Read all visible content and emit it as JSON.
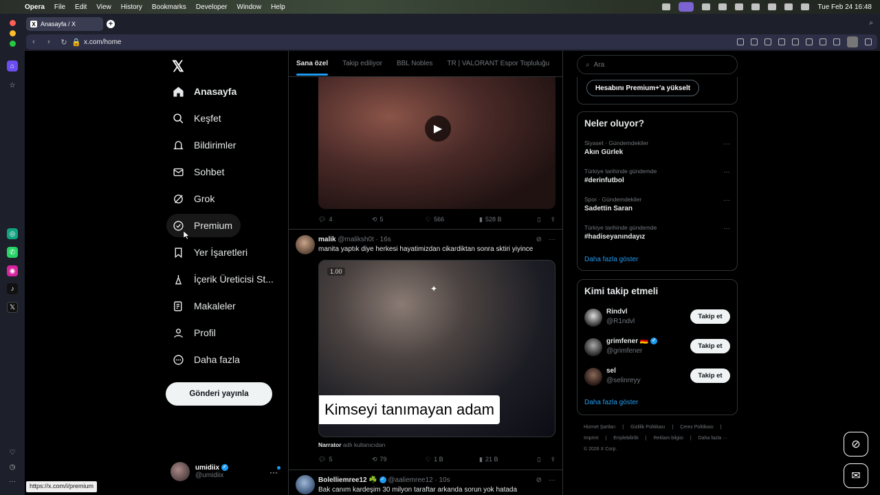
{
  "menubar": {
    "app": "Opera",
    "items": [
      "File",
      "Edit",
      "View",
      "History",
      "Bookmarks",
      "Developer",
      "Window",
      "Help"
    ],
    "datetime": "Tue Feb 24  16:48"
  },
  "tab": {
    "title": "Anasayfa / X"
  },
  "address": {
    "url": "x.com/home"
  },
  "leftnav": {
    "items": [
      {
        "label": "Anasayfa",
        "icon": "home-icon"
      },
      {
        "label": "Keşfet",
        "icon": "search-icon"
      },
      {
        "label": "Bildirimler",
        "icon": "bell-icon"
      },
      {
        "label": "Sohbet",
        "icon": "mail-icon"
      },
      {
        "label": "Grok",
        "icon": "grok-icon"
      },
      {
        "label": "Premium",
        "icon": "verified-icon"
      },
      {
        "label": "Yer İşaretleri",
        "icon": "bookmark-icon"
      },
      {
        "label": "İçerik Üreticisi St...",
        "icon": "creator-icon"
      },
      {
        "label": "Makaleler",
        "icon": "articles-icon"
      },
      {
        "label": "Profil",
        "icon": "profile-icon"
      },
      {
        "label": "Daha fazla",
        "icon": "more-circle-icon"
      }
    ],
    "post_button": "Gönderi yayınla",
    "me": {
      "name": "umidiix",
      "handle": "@umidiix"
    }
  },
  "timeline": {
    "tabs": [
      "Sana özel",
      "Takip ediliyor",
      "BBL Nobles",
      "TR | VALORANT Espor Topluluğu"
    ],
    "tweet1_actions": {
      "replies": "4",
      "reposts": "5",
      "likes": "566",
      "views": "528 B"
    },
    "tweet2": {
      "name": "malik",
      "handle": "@maliksh0t",
      "time": "16s",
      "text": "manita yaptık diye herkesi hayatimizdan cikardiktan sonra sktiri yiyince",
      "timestamp": "1.00",
      "caption": "Kimseyi tanımayan adam",
      "narrator_name": "Narrator",
      "narrator_suffix": "adlı kullanıcıdan",
      "replies": "5",
      "reposts": "79",
      "likes": "1 B",
      "views": "21 B"
    },
    "tweet3": {
      "name": "Bolelliemree12 ☘️",
      "handle": "@aaliemree12",
      "time": "10s",
      "text": "Bak canım kardeşim 30 milyon taraftar arkanda sorun yok hatada"
    }
  },
  "right": {
    "search_placeholder": "Ara",
    "premium_btn": "Hesabını Premium+'a yükselt",
    "trends_title": "Neler oluyor?",
    "trends": [
      {
        "meta": "Siyaset · Gündemdekiler",
        "name": "Akın Gürlek"
      },
      {
        "meta": "Türkiye tarihinde gündemde",
        "name": "#derinfutbol"
      },
      {
        "meta": "Spor · Gündemdekiler",
        "name": "Sadettin Saran"
      },
      {
        "meta": "Türkiye tarihinde gündemde",
        "name": "#hadiseyanındayız"
      }
    ],
    "show_more": "Daha fazla göster",
    "who_title": "Kimi takip etmeli",
    "who": [
      {
        "name": "Rindvl",
        "handle": "@R1ndvl",
        "button": "Takip et"
      },
      {
        "name": "grimfener 🇩🇪",
        "handle": "@grimfener",
        "button": "Takip et"
      },
      {
        "name": "sel",
        "handle": "@selinreyy",
        "button": "Takip et"
      }
    ],
    "who_more": "Daha fazla göster",
    "footer_line1": [
      "Hizmet Şartları",
      "|",
      "Gizlilik Politikası",
      "|",
      "Çerez Politikası",
      "|"
    ],
    "footer_line2": [
      "Imprint",
      "|",
      "Erişilebilirlik",
      "|",
      "Reklam bilgisi",
      "|",
      "Daha fazla ···"
    ],
    "footer_copy": "© 2026 X Corp."
  },
  "status_url": "https://x.com/i/premium"
}
